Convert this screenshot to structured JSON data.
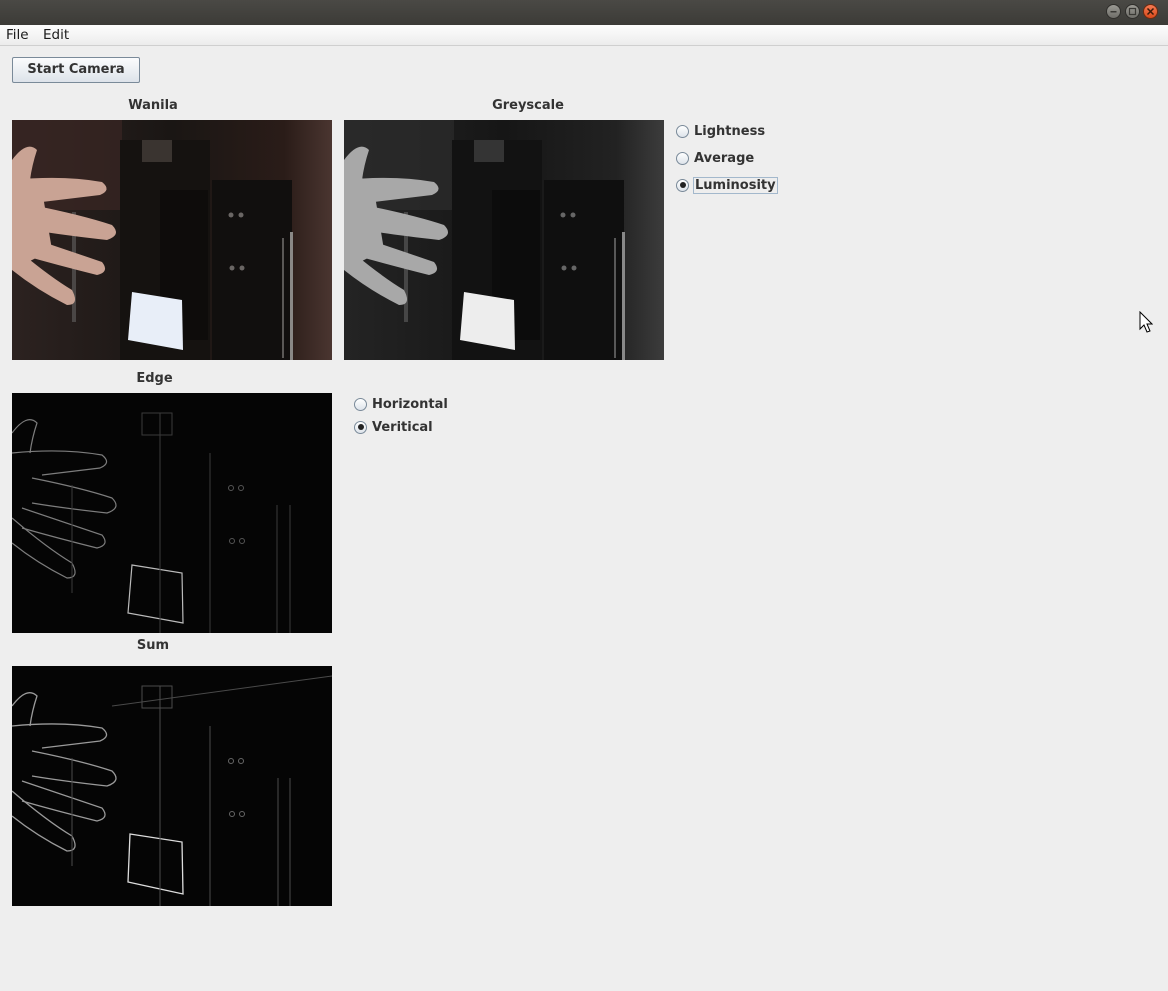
{
  "menu": {
    "file": "File",
    "edit": "Edit"
  },
  "toolbar": {
    "start_camera": "Start Camera"
  },
  "panels": {
    "original": "Wanila",
    "greyscale": "Greyscale",
    "edge": "Edge",
    "sum": "Sum"
  },
  "greyscale_options": {
    "items": [
      "Lightness",
      "Average",
      "Luminosity"
    ],
    "selected": "Luminosity"
  },
  "edge_options": {
    "items": [
      "Horizontal",
      "Veritical"
    ],
    "selected": "Veritical"
  },
  "icons": {
    "minimize": "minimize-icon",
    "maximize": "maximize-icon",
    "close": "close-icon",
    "cursor": "mouse-pointer-icon"
  }
}
